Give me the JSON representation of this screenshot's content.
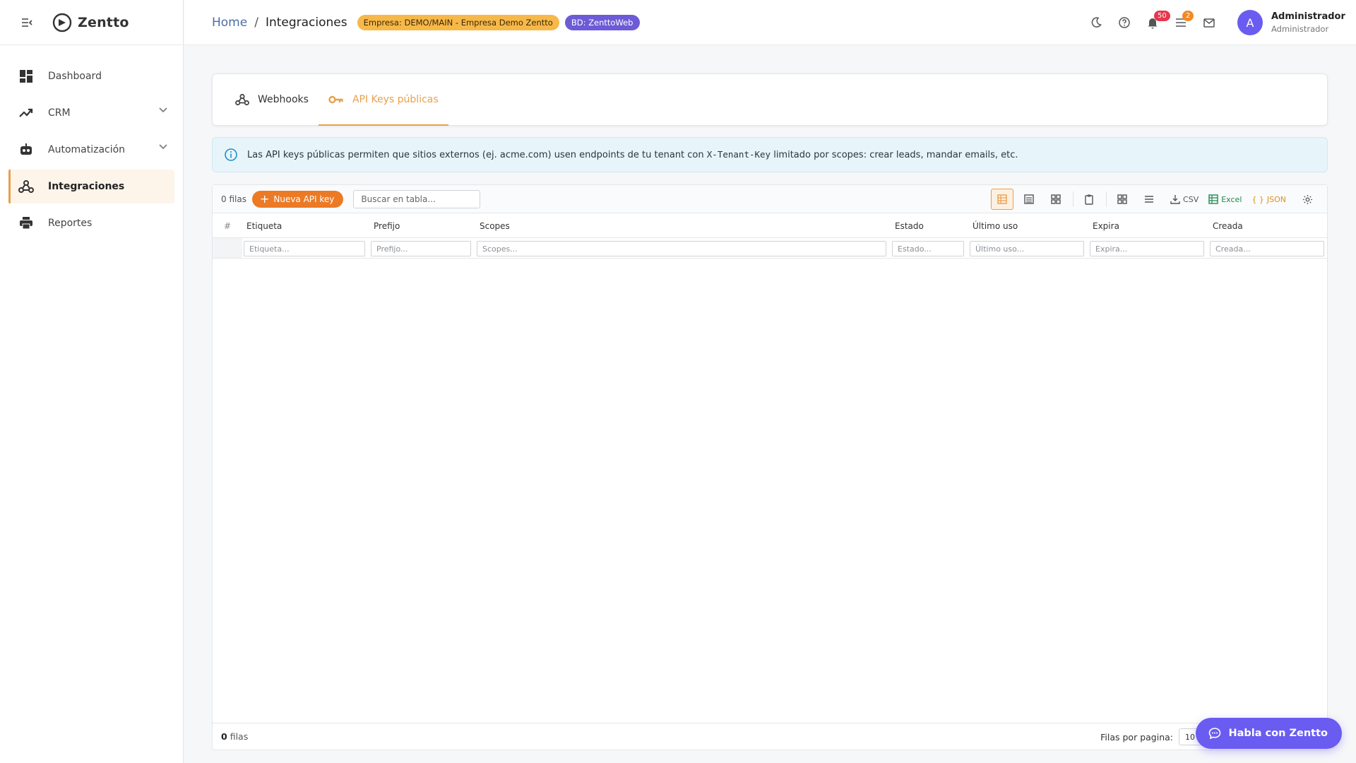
{
  "app": {
    "name": "Zentto"
  },
  "sidebar": {
    "items": [
      {
        "label": "Dashboard",
        "icon": "dashboard-icon"
      },
      {
        "label": "CRM",
        "icon": "trending-up-icon",
        "expandable": true
      },
      {
        "label": "Automatización",
        "icon": "robot-icon",
        "expandable": true
      },
      {
        "label": "Integraciones",
        "icon": "webhook-icon",
        "active": true
      },
      {
        "label": "Reportes",
        "icon": "printer-icon"
      }
    ]
  },
  "header": {
    "breadcrumb": {
      "home": "Home",
      "separator": "/",
      "current": "Integraciones"
    },
    "chip_empresa": "Empresa: DEMO/MAIN - Empresa Demo Zentto",
    "chip_bd": "BD: ZenttoWeb",
    "notifications_count": "50",
    "tasks_count": "2",
    "user": {
      "initial": "A",
      "name": "Administrador",
      "role": "Administrador"
    }
  },
  "tabs": [
    {
      "label": "Webhooks",
      "icon": "webhook-icon"
    },
    {
      "label": "API Keys públicas",
      "icon": "key-icon",
      "active": true
    }
  ],
  "info": {
    "before": "Las API keys públicas permiten que sitios externos (ej. acme.com) usen endpoints de tu tenant con ",
    "code": "X-Tenant-Key",
    "after": " limitado por scopes: crear leads, mandar emails, etc."
  },
  "grid": {
    "row_count_label": "0 filas",
    "new_button": "Nueva API key",
    "search_placeholder": "Buscar en tabla...",
    "export": {
      "csv": "CSV",
      "excel": "Excel",
      "json": "JSON"
    },
    "columns": [
      {
        "label": "Etiqueta",
        "placeholder": "Etiqueta..."
      },
      {
        "label": "Prefijo",
        "placeholder": "Prefijo..."
      },
      {
        "label": "Scopes",
        "placeholder": "Scopes..."
      },
      {
        "label": "Estado",
        "placeholder": "Estado..."
      },
      {
        "label": "Último uso",
        "placeholder": "Último uso..."
      },
      {
        "label": "Expira",
        "placeholder": "Expira..."
      },
      {
        "label": "Creada",
        "placeholder": "Creada..."
      }
    ],
    "index_header": "#",
    "footer": {
      "count": "0",
      "count_suffix": "filas",
      "per_page_label": "Filas por pagina:",
      "per_page_value": "10"
    }
  },
  "chat": {
    "label": "Habla con Zentto"
  },
  "colors": {
    "accent": "#e8a04c",
    "primary": "#6a5cf0",
    "new_button": "#ec7a25",
    "info_bg": "#e7f5fb"
  }
}
